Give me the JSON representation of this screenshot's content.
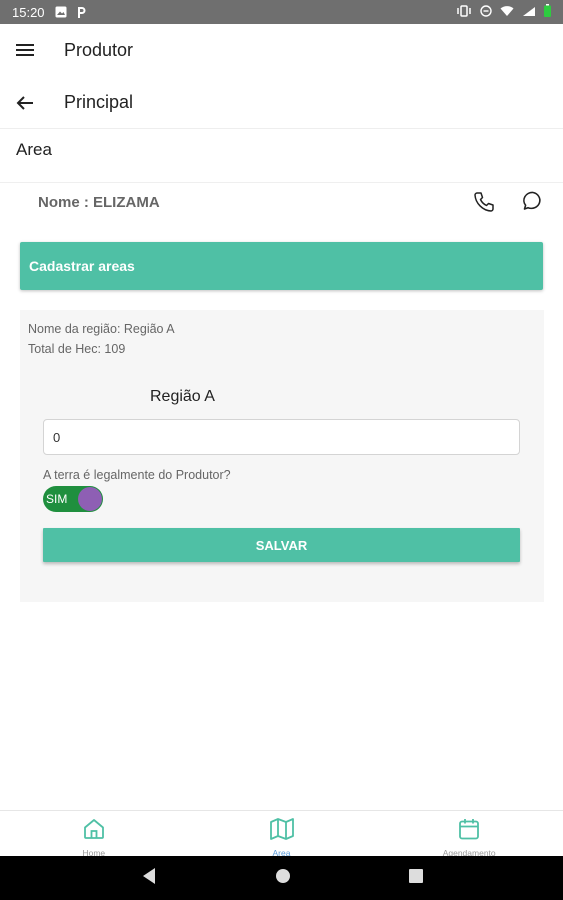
{
  "status_bar": {
    "time": "15:20",
    "left_icons": [
      "gallery-icon",
      "p-app-icon"
    ],
    "right_icons": [
      "vibrate-icon",
      "do-not-disturb-icon",
      "wifi-icon",
      "signal-icon",
      "battery-icon"
    ]
  },
  "appbar1": {
    "title": "Produtor",
    "icon": "menu-icon"
  },
  "appbar2": {
    "title": "Principal",
    "icon": "back-arrow-icon"
  },
  "section_title": "Area",
  "producer": {
    "name_label": "Nome : ELIZAMA",
    "actions": [
      "phone-icon",
      "chat-icon"
    ]
  },
  "register_banner": "Cadastrar areas",
  "region_card": {
    "region_name_line": "Nome da região: Região A",
    "hectares_line": "Total de Hec: 109",
    "region_title": "Região A",
    "input_value": "0",
    "legal_question": "A terra é legalmente do Produtor?",
    "toggle_text": "SIM",
    "toggle_on": true,
    "save_label": "SALVAR"
  },
  "bottom_nav": {
    "items": [
      {
        "label": "Home",
        "icon": "home-icon",
        "active": false
      },
      {
        "label": "Area",
        "icon": "map-icon",
        "active": true
      },
      {
        "label": "Agendamento",
        "icon": "calendar-icon",
        "active": false
      }
    ]
  },
  "colors": {
    "accent": "#4fc0a5",
    "toggle_track": "#1f8f3e",
    "toggle_knob": "#8e5fb4",
    "active_nav": "#5a9bd8"
  }
}
